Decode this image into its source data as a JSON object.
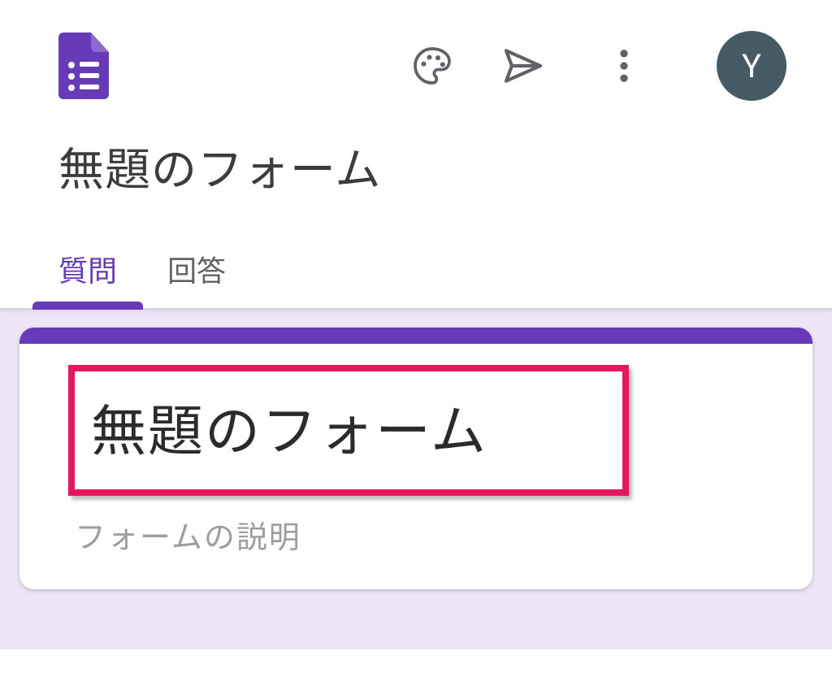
{
  "header": {
    "avatar_initial": "Y"
  },
  "title": {
    "document_title": "無題のフォーム"
  },
  "tabs": {
    "questions": "質問",
    "responses": "回答"
  },
  "form_card": {
    "title": "無題のフォーム",
    "description_placeholder": "フォームの説明"
  }
}
